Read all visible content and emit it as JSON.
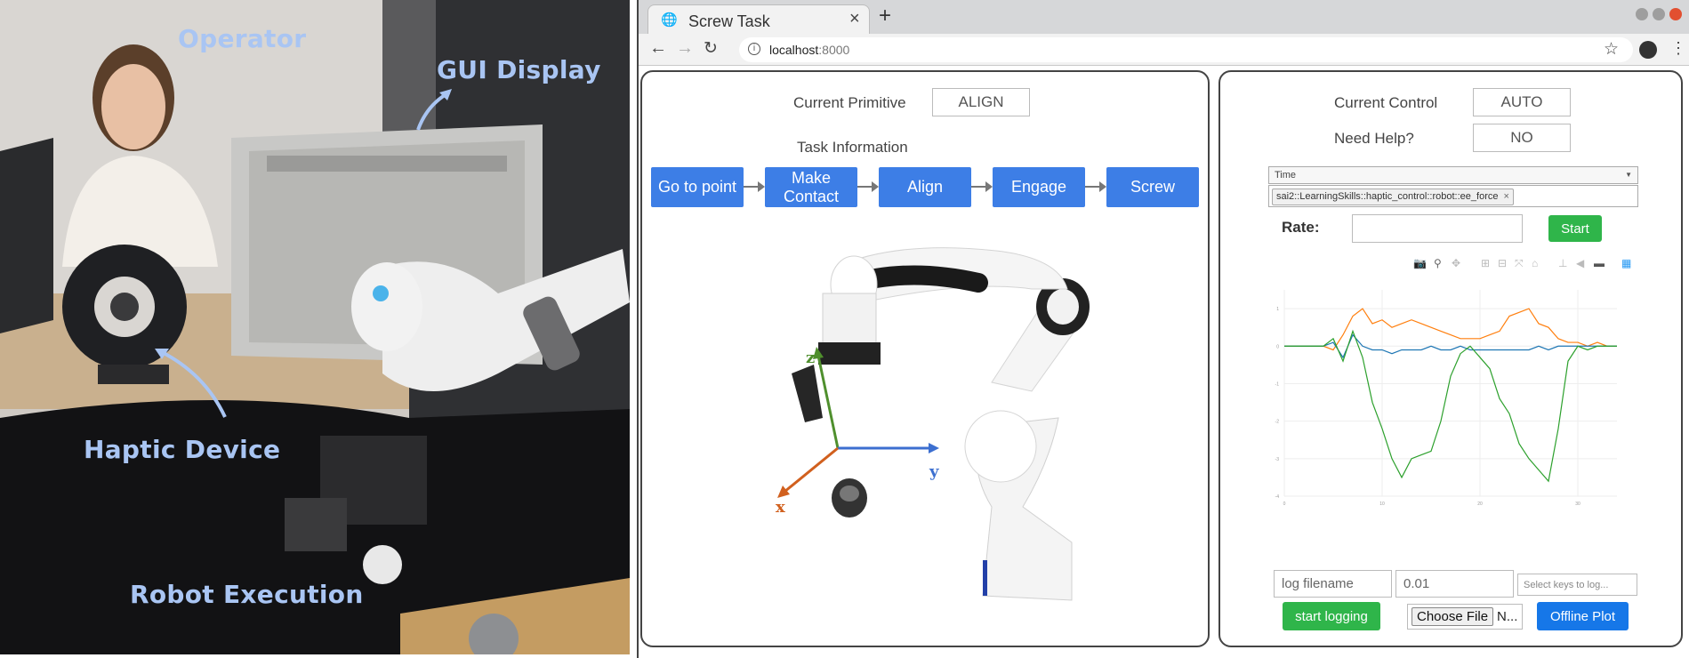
{
  "photo": {
    "labels": {
      "operator": "Operator",
      "gui_display": "GUI Display",
      "haptic_device": "Haptic Device",
      "robot_execution": "Robot Execution"
    }
  },
  "browser": {
    "tab_title": "Screw Task",
    "tab_close": "×",
    "new_tab": "+",
    "url_host": "localhost",
    "url_port": ":8000",
    "window_controls": [
      "minimize",
      "maximize",
      "close"
    ]
  },
  "left_panel": {
    "current_primitive_label": "Current Primitive",
    "current_primitive_value": "ALIGN",
    "task_information_label": "Task Information",
    "steps": [
      "Go to point",
      "Make Contact",
      "Align",
      "Engage",
      "Screw"
    ],
    "axes": {
      "x": "x",
      "y": "y",
      "z": "z"
    },
    "colors": {
      "x_axis": "#d1601e",
      "y_axis": "#3c6fd0",
      "z_axis": "#4f8f2d",
      "step_button": "#3d7ee6"
    }
  },
  "right_panel": {
    "current_control_label": "Current Control",
    "current_control_value": "AUTO",
    "need_help_label": "Need Help?",
    "need_help_value": "NO",
    "x_key_select": "Time",
    "y_key_tag": "sai2::LearningSkills::haptic_control::robot::ee_force",
    "rate_label": "Rate:",
    "rate_value": "",
    "start_button": "Start",
    "log_filename_placeholder": "log filename",
    "log_rate_value": "0.01",
    "log_keys_placeholder": "Select keys to log...",
    "start_logging_button": "start logging",
    "choose_file_button": "Choose File",
    "file_name_text": "N...",
    "offline_plot_button": "Offline Plot",
    "colors": {
      "start": "#2fb54a",
      "offline_plot": "#1677e8"
    }
  },
  "chart_data": {
    "type": "line",
    "title": "",
    "xlabel": "",
    "ylabel": "",
    "x": [
      0,
      1,
      2,
      3,
      4,
      5,
      6,
      7,
      8,
      9,
      10,
      11,
      12,
      13,
      14,
      15,
      16,
      17,
      18,
      19,
      20,
      21,
      22,
      23,
      24,
      25,
      26,
      27,
      28,
      29,
      30,
      31,
      32,
      33,
      34
    ],
    "xlim": [
      0,
      34
    ],
    "ylim": [
      -4,
      1.5
    ],
    "series": [
      {
        "color": "#ff7f0e",
        "values": [
          0,
          0,
          0,
          0,
          0,
          -0.1,
          0.3,
          0.8,
          1.0,
          0.6,
          0.7,
          0.5,
          0.6,
          0.7,
          0.6,
          0.5,
          0.4,
          0.3,
          0.2,
          0.2,
          0.2,
          0.3,
          0.4,
          0.8,
          0.9,
          1.0,
          0.6,
          0.5,
          0.2,
          0.1,
          0.1,
          0.0,
          0.1,
          0.0,
          0.0
        ]
      },
      {
        "color": "#1f77b4",
        "values": [
          0,
          0,
          0,
          0,
          0,
          0.1,
          -0.3,
          0.3,
          0.0,
          -0.1,
          -0.1,
          -0.2,
          -0.1,
          -0.1,
          -0.1,
          0.0,
          -0.1,
          -0.1,
          0.0,
          -0.1,
          -0.1,
          -0.1,
          -0.1,
          -0.1,
          -0.1,
          -0.1,
          0.0,
          -0.1,
          0.0,
          0.0,
          0.0,
          0.0,
          0.0,
          0.0,
          0.0
        ]
      },
      {
        "color": "#2ca02c",
        "values": [
          0,
          0,
          0,
          0,
          0,
          0.2,
          -0.4,
          0.4,
          -0.3,
          -1.5,
          -2.2,
          -3.0,
          -3.5,
          -3.0,
          -2.9,
          -2.8,
          -2.0,
          -0.8,
          -0.2,
          0.0,
          -0.3,
          -0.6,
          -1.4,
          -1.8,
          -2.6,
          -3.0,
          -3.3,
          -3.6,
          -2.2,
          -0.4,
          0.0,
          -0.1,
          0.0,
          0.0,
          0.0
        ]
      }
    ]
  }
}
